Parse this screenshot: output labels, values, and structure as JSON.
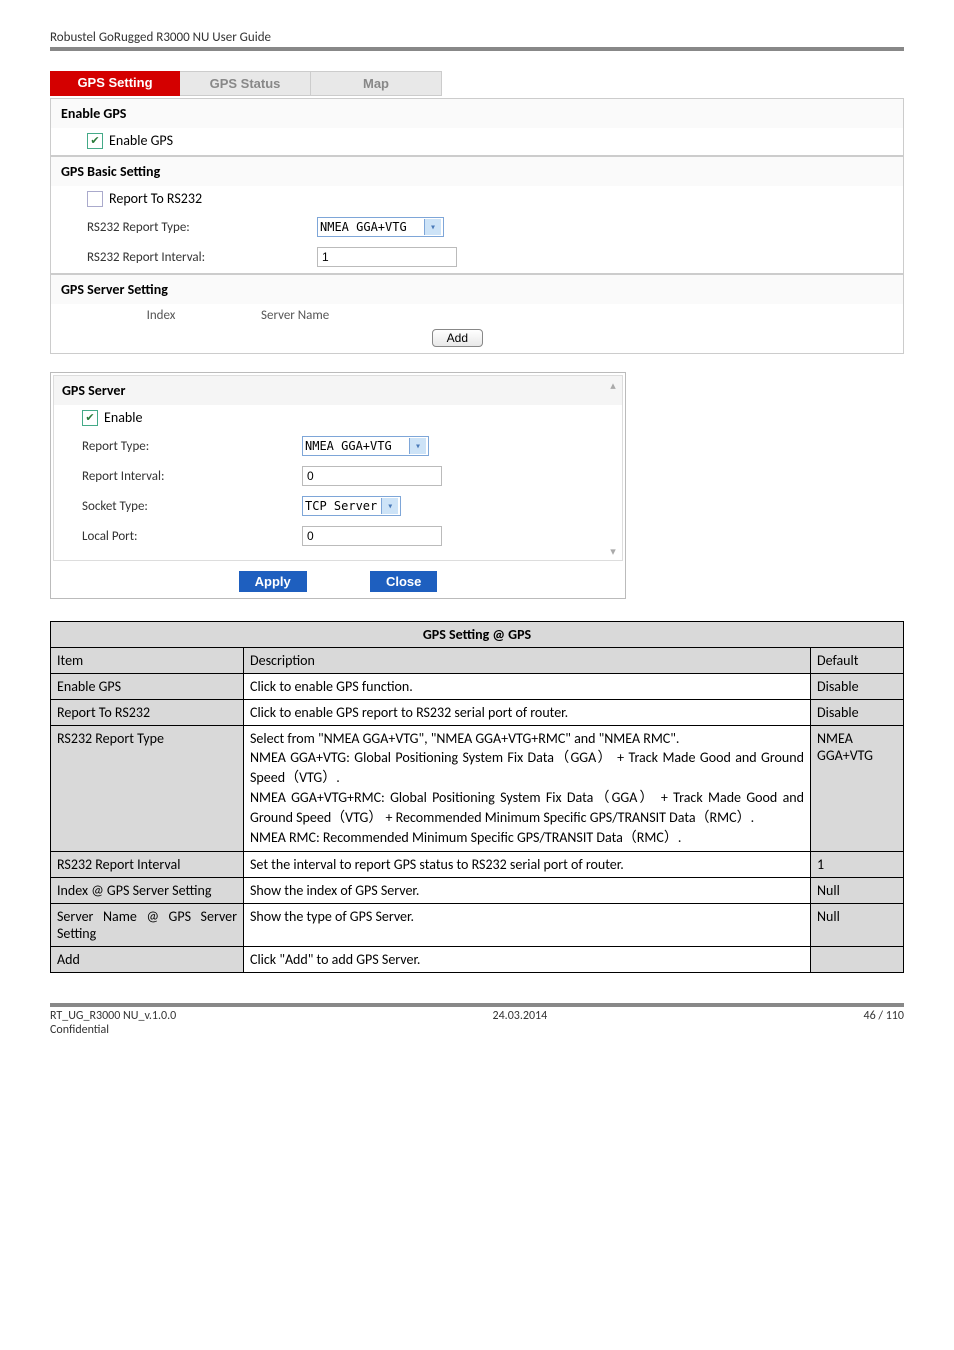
{
  "doc_header": "Robustel GoRugged R3000 NU User Guide",
  "tabs": {
    "setting": "GPS Setting",
    "status": "GPS Status",
    "map": "Map"
  },
  "box1": {
    "sec1_title": "Enable GPS",
    "enable_gps": "Enable GPS",
    "sec2_title": "GPS Basic Setting",
    "report_rs232": "Report To RS232",
    "rs232_type_label": "RS232 Report Type:",
    "rs232_type_value": "NMEA GGA+VTG",
    "rs232_interval_label": "RS232 Report Interval:",
    "rs232_interval_value": "1",
    "sec3_title": "GPS Server Setting",
    "col_index": "Index",
    "col_server": "Server Name",
    "add_btn": "Add"
  },
  "modal": {
    "title": "GPS Server",
    "enable": "Enable",
    "report_type_label": "Report Type:",
    "report_type_value": "NMEA GGA+VTG",
    "report_interval_label": "Report Interval:",
    "report_interval_value": "0",
    "socket_type_label": "Socket Type:",
    "socket_type_value": "TCP Server",
    "local_port_label": "Local Port:",
    "local_port_value": "0",
    "apply": "Apply",
    "close": "Close"
  },
  "table": {
    "title": "GPS Setting @ GPS",
    "h_item": "Item",
    "h_desc": "Description",
    "h_def": "Default",
    "rows": [
      {
        "item": "Enable GPS",
        "desc": "Click to enable GPS function.",
        "def": "Disable"
      },
      {
        "item": "Report To RS232",
        "desc": "Click to enable GPS report to RS232 serial port of router.",
        "def": "Disable"
      },
      {
        "item": "RS232 Report Type",
        "desc": "Select from \"NMEA GGA+VTG\", \"NMEA GGA+VTG+RMC\" and \"NMEA RMC\".\nNMEA GGA+VTG: Global Positioning System Fix Data（GGA） + Track Made Good and Ground Speed（VTG）.\nNMEA GGA+VTG+RMC: Global Positioning System Fix Data（GGA） + Track Made Good and Ground Speed（VTG） + Recommended Minimum Specific GPS/TRANSIT Data（RMC）.\nNMEA RMC: Recommended Minimum Specific GPS/TRANSIT Data（RMC）.",
        "def": "NMEA GGA+VTG"
      },
      {
        "item": "RS232 Report Interval",
        "desc": "Set the interval to report GPS status to RS232 serial port of router.",
        "def": "1"
      },
      {
        "item": "Index @ GPS Server Setting",
        "desc": "Show the index of GPS Server.",
        "def": "Null"
      },
      {
        "item": "Server Name @ GPS Server Setting",
        "desc": "Show the type of GPS Server.",
        "def": "Null"
      },
      {
        "item": "Add",
        "desc": "Click \"Add\" to add GPS Server.",
        "def": ""
      }
    ]
  },
  "footer": {
    "left1": "RT_UG_R3000 NU_v.1.0.0",
    "left2": "Confidential",
    "center": "24.03.2014",
    "right": "46 / 110"
  }
}
